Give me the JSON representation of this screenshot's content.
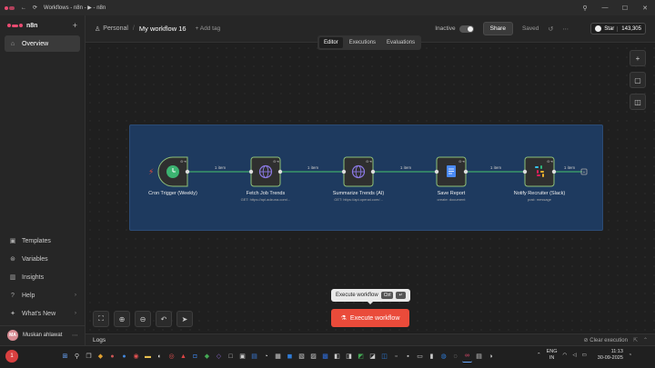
{
  "titlebar": {
    "title": "Workflows - n8n - ▶ - n8n",
    "minimize": "—",
    "maximize": "☐",
    "close": "✕"
  },
  "sidebar": {
    "brand": "n8n",
    "plus": "+",
    "items": [
      {
        "label": "Overview",
        "icon": "home-icon"
      }
    ],
    "bottom_items": [
      {
        "label": "Templates",
        "icon": "templates-icon"
      },
      {
        "label": "Variables",
        "icon": "variables-icon"
      },
      {
        "label": "Insights",
        "icon": "insights-icon"
      },
      {
        "label": "Help",
        "icon": "help-icon"
      },
      {
        "label": "What's New",
        "icon": "whats-new-icon"
      }
    ],
    "user": {
      "initials": "MA",
      "name": "Muskan ahlawat"
    }
  },
  "topbar": {
    "project": "Personal",
    "separator": "/",
    "workflow_name": "My workflow 16",
    "add_tag": "+ Add tag",
    "status": "Inactive",
    "share": "Share",
    "saved": "Saved",
    "star_label": "Star",
    "star_count": "143,305"
  },
  "tabs": [
    {
      "label": "Editor",
      "active": true
    },
    {
      "label": "Executions",
      "active": false
    },
    {
      "label": "Evaluations",
      "active": false
    }
  ],
  "nodes": [
    {
      "name": "Cron Trigger (Weekly)",
      "subtitle": "",
      "icon": "clock-icon",
      "color": "#3cb371"
    },
    {
      "name": "Fetch Job Trends",
      "subtitle": "GET: https://api.adzuna.com/...",
      "icon": "globe-icon",
      "color": "#8c7ae6"
    },
    {
      "name": "Summarize Trends (AI)",
      "subtitle": "GET: https://api.openai.com/...",
      "icon": "globe-icon",
      "color": "#8c7ae6"
    },
    {
      "name": "Save Report",
      "subtitle": "create: document",
      "icon": "google-docs-icon",
      "color": "#4a8af4"
    },
    {
      "name": "Notify Recruiter (Slack)",
      "subtitle": "post: message",
      "icon": "slack-icon",
      "color": "#e01e5a"
    }
  ],
  "connections": [
    "1 item",
    "1 item",
    "1 item",
    "1 item",
    "1 item"
  ],
  "execute": {
    "tooltip": "Execute workflow",
    "kbd1": "Ctrl",
    "kbd2": "↵",
    "button": "Execute workflow"
  },
  "logs": {
    "title": "Logs",
    "clear": "Clear execution"
  },
  "taskbar": {
    "weather_badge": "1",
    "lang_top": "ENG",
    "lang_bottom": "IN",
    "time": "11:13",
    "date": "30-09-2025"
  },
  "colors": {
    "accent": "#ea4b71",
    "execute": "#ea4b3a",
    "sticky": "#1e3a5f",
    "connection": "#3fa96b"
  }
}
